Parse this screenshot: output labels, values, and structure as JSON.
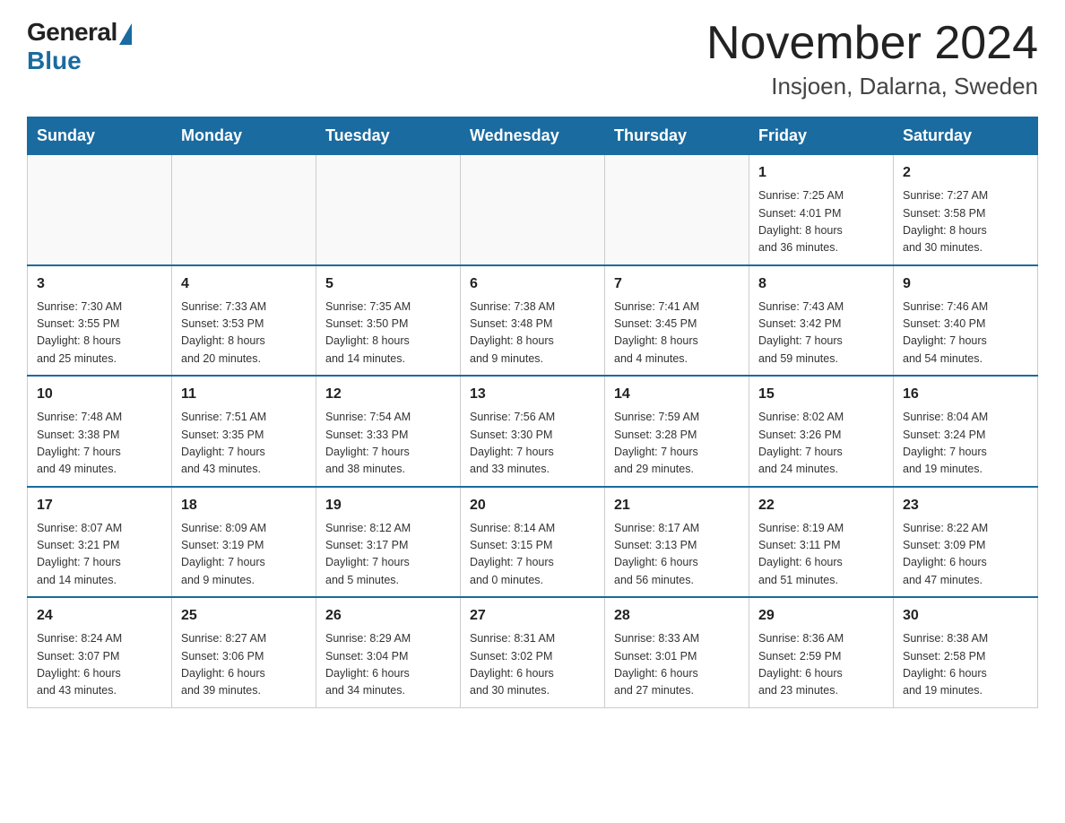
{
  "header": {
    "logo_general": "General",
    "logo_blue": "Blue",
    "title": "November 2024",
    "subtitle": "Insjoen, Dalarna, Sweden"
  },
  "days_of_week": [
    "Sunday",
    "Monday",
    "Tuesday",
    "Wednesday",
    "Thursday",
    "Friday",
    "Saturday"
  ],
  "weeks": [
    {
      "days": [
        {
          "num": "",
          "info": ""
        },
        {
          "num": "",
          "info": ""
        },
        {
          "num": "",
          "info": ""
        },
        {
          "num": "",
          "info": ""
        },
        {
          "num": "",
          "info": ""
        },
        {
          "num": "1",
          "info": "Sunrise: 7:25 AM\nSunset: 4:01 PM\nDaylight: 8 hours\nand 36 minutes."
        },
        {
          "num": "2",
          "info": "Sunrise: 7:27 AM\nSunset: 3:58 PM\nDaylight: 8 hours\nand 30 minutes."
        }
      ]
    },
    {
      "days": [
        {
          "num": "3",
          "info": "Sunrise: 7:30 AM\nSunset: 3:55 PM\nDaylight: 8 hours\nand 25 minutes."
        },
        {
          "num": "4",
          "info": "Sunrise: 7:33 AM\nSunset: 3:53 PM\nDaylight: 8 hours\nand 20 minutes."
        },
        {
          "num": "5",
          "info": "Sunrise: 7:35 AM\nSunset: 3:50 PM\nDaylight: 8 hours\nand 14 minutes."
        },
        {
          "num": "6",
          "info": "Sunrise: 7:38 AM\nSunset: 3:48 PM\nDaylight: 8 hours\nand 9 minutes."
        },
        {
          "num": "7",
          "info": "Sunrise: 7:41 AM\nSunset: 3:45 PM\nDaylight: 8 hours\nand 4 minutes."
        },
        {
          "num": "8",
          "info": "Sunrise: 7:43 AM\nSunset: 3:42 PM\nDaylight: 7 hours\nand 59 minutes."
        },
        {
          "num": "9",
          "info": "Sunrise: 7:46 AM\nSunset: 3:40 PM\nDaylight: 7 hours\nand 54 minutes."
        }
      ]
    },
    {
      "days": [
        {
          "num": "10",
          "info": "Sunrise: 7:48 AM\nSunset: 3:38 PM\nDaylight: 7 hours\nand 49 minutes."
        },
        {
          "num": "11",
          "info": "Sunrise: 7:51 AM\nSunset: 3:35 PM\nDaylight: 7 hours\nand 43 minutes."
        },
        {
          "num": "12",
          "info": "Sunrise: 7:54 AM\nSunset: 3:33 PM\nDaylight: 7 hours\nand 38 minutes."
        },
        {
          "num": "13",
          "info": "Sunrise: 7:56 AM\nSunset: 3:30 PM\nDaylight: 7 hours\nand 33 minutes."
        },
        {
          "num": "14",
          "info": "Sunrise: 7:59 AM\nSunset: 3:28 PM\nDaylight: 7 hours\nand 29 minutes."
        },
        {
          "num": "15",
          "info": "Sunrise: 8:02 AM\nSunset: 3:26 PM\nDaylight: 7 hours\nand 24 minutes."
        },
        {
          "num": "16",
          "info": "Sunrise: 8:04 AM\nSunset: 3:24 PM\nDaylight: 7 hours\nand 19 minutes."
        }
      ]
    },
    {
      "days": [
        {
          "num": "17",
          "info": "Sunrise: 8:07 AM\nSunset: 3:21 PM\nDaylight: 7 hours\nand 14 minutes."
        },
        {
          "num": "18",
          "info": "Sunrise: 8:09 AM\nSunset: 3:19 PM\nDaylight: 7 hours\nand 9 minutes."
        },
        {
          "num": "19",
          "info": "Sunrise: 8:12 AM\nSunset: 3:17 PM\nDaylight: 7 hours\nand 5 minutes."
        },
        {
          "num": "20",
          "info": "Sunrise: 8:14 AM\nSunset: 3:15 PM\nDaylight: 7 hours\nand 0 minutes."
        },
        {
          "num": "21",
          "info": "Sunrise: 8:17 AM\nSunset: 3:13 PM\nDaylight: 6 hours\nand 56 minutes."
        },
        {
          "num": "22",
          "info": "Sunrise: 8:19 AM\nSunset: 3:11 PM\nDaylight: 6 hours\nand 51 minutes."
        },
        {
          "num": "23",
          "info": "Sunrise: 8:22 AM\nSunset: 3:09 PM\nDaylight: 6 hours\nand 47 minutes."
        }
      ]
    },
    {
      "days": [
        {
          "num": "24",
          "info": "Sunrise: 8:24 AM\nSunset: 3:07 PM\nDaylight: 6 hours\nand 43 minutes."
        },
        {
          "num": "25",
          "info": "Sunrise: 8:27 AM\nSunset: 3:06 PM\nDaylight: 6 hours\nand 39 minutes."
        },
        {
          "num": "26",
          "info": "Sunrise: 8:29 AM\nSunset: 3:04 PM\nDaylight: 6 hours\nand 34 minutes."
        },
        {
          "num": "27",
          "info": "Sunrise: 8:31 AM\nSunset: 3:02 PM\nDaylight: 6 hours\nand 30 minutes."
        },
        {
          "num": "28",
          "info": "Sunrise: 8:33 AM\nSunset: 3:01 PM\nDaylight: 6 hours\nand 27 minutes."
        },
        {
          "num": "29",
          "info": "Sunrise: 8:36 AM\nSunset: 2:59 PM\nDaylight: 6 hours\nand 23 minutes."
        },
        {
          "num": "30",
          "info": "Sunrise: 8:38 AM\nSunset: 2:58 PM\nDaylight: 6 hours\nand 19 minutes."
        }
      ]
    }
  ]
}
